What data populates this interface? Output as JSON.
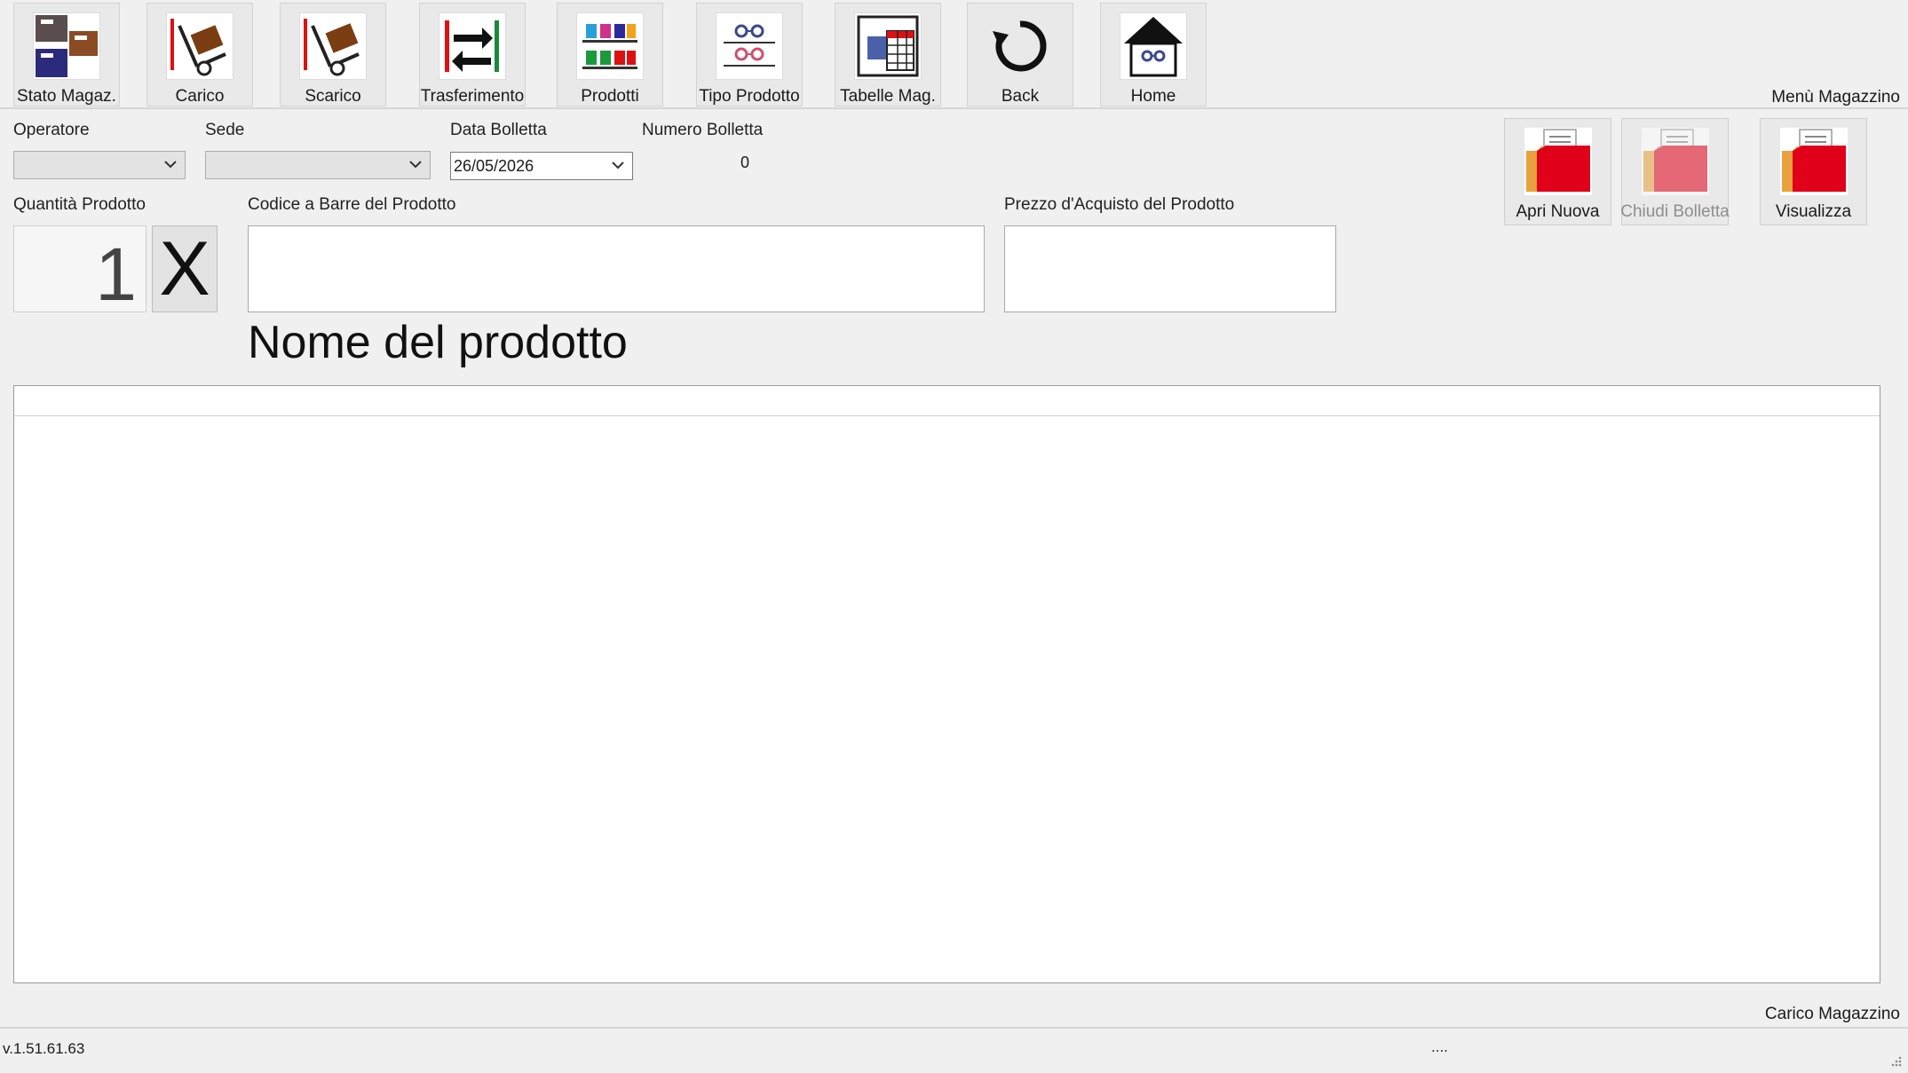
{
  "toolbar": {
    "items": [
      {
        "label": "Stato Magaz.",
        "icon": "warehouse-boxes-icon"
      },
      {
        "label": "Carico",
        "icon": "hand-truck-load-icon"
      },
      {
        "label": "Scarico",
        "icon": "hand-truck-unload-icon"
      },
      {
        "label": "Trasferimento",
        "icon": "transfer-arrows-icon"
      },
      {
        "label": "Prodotti",
        "icon": "products-shelf-icon"
      },
      {
        "label": "Tipo Prodotto",
        "icon": "glasses-shelf-icon"
      },
      {
        "label": "Tabelle Mag.",
        "icon": "tables-icon"
      },
      {
        "label": "Back",
        "icon": "back-arrow-icon"
      },
      {
        "label": "Home",
        "icon": "home-icon"
      }
    ],
    "section_title": "Menù Magazzino"
  },
  "form": {
    "operatore_label": "Operatore",
    "operatore_value": "",
    "sede_label": "Sede",
    "sede_value": "",
    "data_label": "Data Bolletta",
    "data_value": "26/05/2026",
    "numero_label": "Numero Bolletta",
    "numero_value": "0",
    "quantita_label": "Quantità Prodotto",
    "quantita_value": "1",
    "multiply_label": "X",
    "codice_label": "Codice a Barre del  Prodotto",
    "codice_value": "",
    "prezzo_label": "Prezzo d'Acquisto del  Prodotto",
    "prezzo_value": "",
    "product_name": "Nome del prodotto"
  },
  "actions": {
    "apri_nuova": "Apri Nuova",
    "chiudi_bolletta": "Chiudi Bolletta",
    "visualizza": "Visualizza"
  },
  "footer": {
    "page_title": "Carico Magazzino",
    "version": "v.1.51.61.63",
    "status": "...."
  },
  "colors": {
    "folder_red": "#e0001a",
    "background": "#f0f0f0"
  }
}
